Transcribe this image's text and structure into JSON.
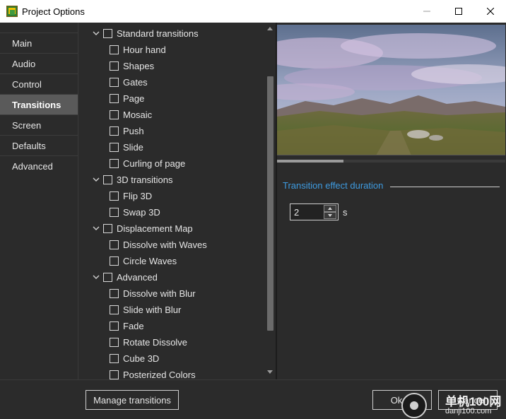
{
  "window": {
    "title": "Project Options"
  },
  "nav": {
    "items": [
      {
        "label": "Main",
        "active": false
      },
      {
        "label": "Audio",
        "active": false
      },
      {
        "label": "Control",
        "active": false
      },
      {
        "label": "Transitions",
        "active": true
      },
      {
        "label": "Screen",
        "active": false
      },
      {
        "label": "Defaults",
        "active": false
      },
      {
        "label": "Advanced",
        "active": false
      }
    ]
  },
  "tree": {
    "groups": [
      {
        "label": "Standard transitions",
        "items": [
          "Hour hand",
          "Shapes",
          "Gates",
          "Page",
          "Mosaic",
          "Push",
          "Slide",
          "Curling of page"
        ]
      },
      {
        "label": "3D transitions",
        "items": [
          "Flip 3D",
          "Swap 3D"
        ]
      },
      {
        "label": "Displacement Map",
        "items": [
          "Dissolve with Waves",
          "Circle Waves"
        ]
      },
      {
        "label": "Advanced",
        "items": [
          "Dissolve with Blur",
          "Slide with Blur",
          "Fade",
          "Rotate Dissolve",
          "Cube 3D",
          "Posterized Colors"
        ]
      }
    ]
  },
  "settings": {
    "section_title": "Transition effect duration",
    "duration_value": "2",
    "duration_unit": "s"
  },
  "buttons": {
    "manage": "Manage transitions",
    "ok": "Ok",
    "cancel": "Cancel"
  },
  "watermark": {
    "text": "单机100网",
    "url": "danji100.com"
  },
  "colors": {
    "accent": "#3e9be0",
    "active_nav": "#5a5a5a",
    "background": "#2b2b2b"
  }
}
